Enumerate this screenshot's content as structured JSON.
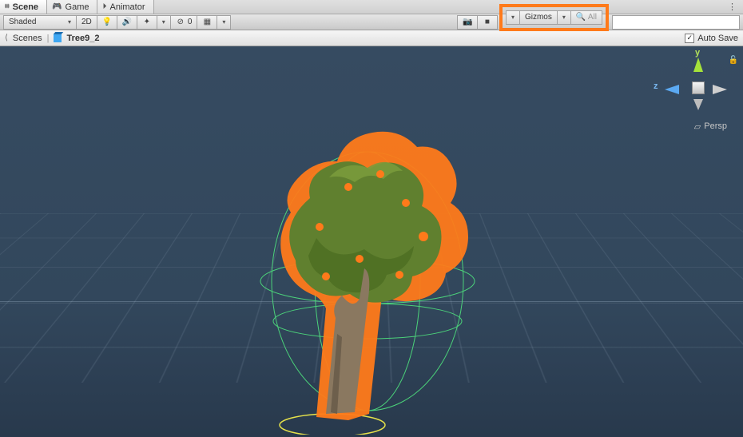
{
  "tabs": [
    {
      "label": "Scene",
      "icon": "⌗",
      "active": true
    },
    {
      "label": "Game",
      "icon": "🎮",
      "active": false
    },
    {
      "label": "Animator",
      "icon": "⏵",
      "active": false
    }
  ],
  "toolbar": {
    "shade_mode": "Shaded",
    "mode_2d": "2D",
    "layers_off": "0",
    "gizmos_label": "Gizmos",
    "search_placeholder": "All",
    "icons": {
      "light": "lightbulb",
      "audio": "speaker",
      "fx": "fx",
      "hidden": "eye-off",
      "grid": "grid",
      "camera": "camera",
      "tool": "tool",
      "search": "search"
    }
  },
  "breadcrumb": {
    "root_label": "Scenes",
    "asset_label": "Tree9_2",
    "auto_save_label": "Auto Save",
    "auto_save_checked": true
  },
  "gizmo": {
    "y": "y",
    "z": "z",
    "mode": "Persp"
  },
  "highlight_color": "#ff7a1a",
  "tree": {
    "outline_color": "#ff7a1a",
    "foliage_color": "#5f7a2a",
    "wire_color": "#4fe27e",
    "base_ring_color": "#e6e24a"
  }
}
